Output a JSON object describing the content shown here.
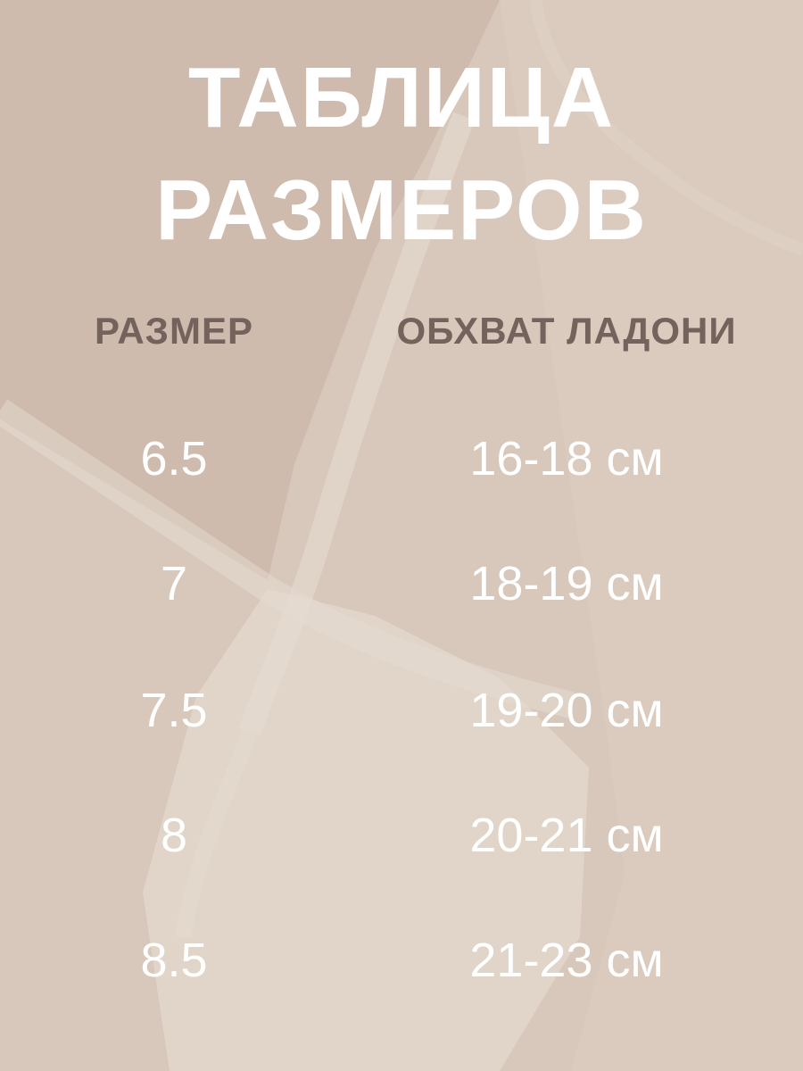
{
  "title": {
    "line1": "ТАБЛИЦА",
    "line2": "РАЗМЕРОВ"
  },
  "table": {
    "headers": {
      "size": "РАЗМЕР",
      "girth": "ОБХВАТ ЛАДОНИ"
    },
    "rows": [
      {
        "size": "6.5",
        "girth": "16-18 см"
      },
      {
        "size": "7",
        "girth": "18-19 см"
      },
      {
        "size": "7.5",
        "girth": "19-20 см"
      },
      {
        "size": "8",
        "girth": "20-21 см"
      },
      {
        "size": "8.5",
        "girth": "21-23 см"
      }
    ]
  },
  "colors": {
    "background": "#d8c8bb",
    "text": "#ffffff",
    "header_text": "#74625c"
  }
}
